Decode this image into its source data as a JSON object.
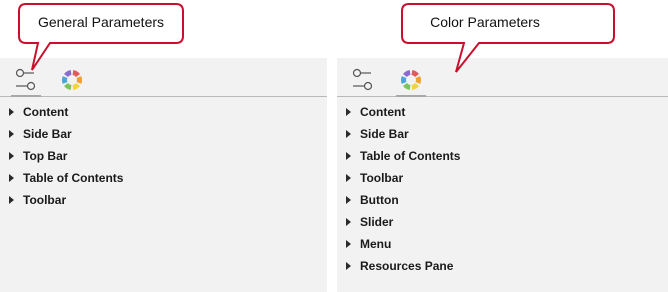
{
  "callouts": {
    "general": "General Parameters",
    "color": "Color Parameters"
  },
  "left_panel": {
    "tabs": [
      {
        "icon": "settings-sliders-icon",
        "active": true
      },
      {
        "icon": "color-wheel-icon",
        "active": false
      }
    ],
    "items": [
      "Content",
      "Side Bar",
      "Top Bar",
      "Table of Contents",
      "Toolbar"
    ]
  },
  "right_panel": {
    "tabs": [
      {
        "icon": "settings-sliders-icon",
        "active": false
      },
      {
        "icon": "color-wheel-icon",
        "active": true
      }
    ],
    "items": [
      "Content",
      "Side Bar",
      "Table of Contents",
      "Toolbar",
      "Button",
      "Slider",
      "Menu",
      "Resources Pane"
    ]
  },
  "colors": {
    "callout_border": "#c8102e",
    "panel_bg": "#f2f2f2",
    "color_wheel": [
      "#e05a5a",
      "#f0a030",
      "#f3d43a",
      "#7cc45a",
      "#4aa6d8",
      "#8a6ad0"
    ]
  }
}
